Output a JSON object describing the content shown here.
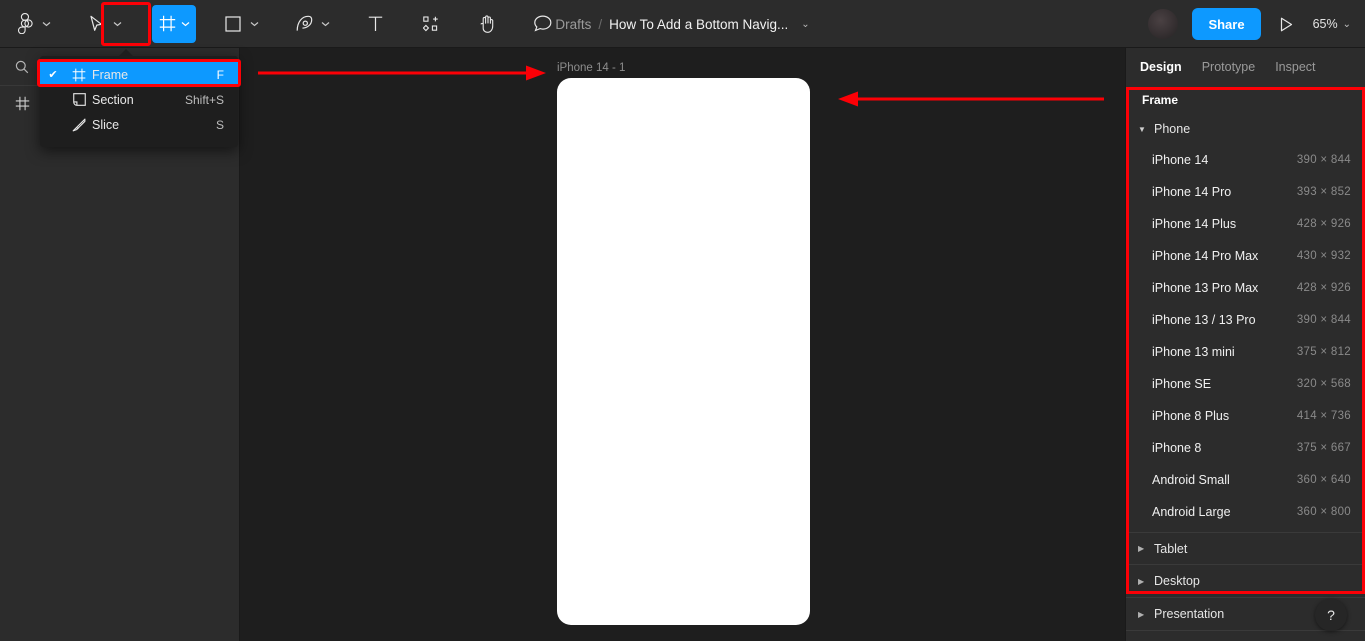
{
  "app": {
    "name": "Figma",
    "accent_color": "#0d99ff",
    "annotation_color": "#fc0006",
    "bg_color": "#1e1e1e",
    "panel_color": "#2c2c2c"
  },
  "toolbar": {
    "tools": [
      {
        "name": "figma-menu",
        "icon": "figma-logo-icon",
        "has_caret": true,
        "active": false
      },
      {
        "name": "move-tool",
        "icon": "cursor-arrow-icon",
        "has_caret": true,
        "active": false
      },
      {
        "name": "frame-tool",
        "icon": "frame-icon",
        "has_caret": true,
        "active": true
      },
      {
        "name": "shape-tool",
        "icon": "square-icon",
        "has_caret": true,
        "active": false
      },
      {
        "name": "pen-tool",
        "icon": "pen-icon",
        "has_caret": true,
        "active": false
      },
      {
        "name": "text-tool",
        "icon": "text-t-icon",
        "has_caret": false,
        "active": false
      },
      {
        "name": "resources-tool",
        "icon": "components-plus-icon",
        "has_caret": false,
        "active": false
      },
      {
        "name": "hand-tool",
        "icon": "hand-icon",
        "has_caret": false,
        "active": false
      },
      {
        "name": "comment-tool",
        "icon": "comment-bubble-icon",
        "has_caret": false,
        "active": false
      }
    ],
    "breadcrumb": {
      "project": "Drafts",
      "separator": "/",
      "file_title": "How To Add a Bottom Navig...",
      "caret": "⌄"
    },
    "share_label": "Share",
    "zoom_level": "65%",
    "zoom_caret": "⌄"
  },
  "left_panel": {
    "search_icon": "search-icon",
    "pages_icon": "hash-grid-icon"
  },
  "frame_menu": {
    "items": [
      {
        "label": "Frame",
        "shortcut": "F",
        "icon": "frame-icon",
        "checked": true,
        "selected": true
      },
      {
        "label": "Section",
        "shortcut": "Shift+S",
        "icon": "section-icon",
        "checked": false,
        "selected": false
      },
      {
        "label": "Slice",
        "shortcut": "S",
        "icon": "slice-knife-icon",
        "checked": false,
        "selected": false
      }
    ],
    "check_glyph": "✔"
  },
  "canvas": {
    "frame_label": "iPhone 14 - 1",
    "frame_fill": "#ffffff"
  },
  "right_panel": {
    "tabs": [
      {
        "label": "Design",
        "active": true
      },
      {
        "label": "Prototype",
        "active": false
      },
      {
        "label": "Inspect",
        "active": false
      }
    ],
    "frame_heading": "Frame",
    "group": {
      "label": "Phone",
      "caret": "▼",
      "expanded": true
    },
    "devices": [
      {
        "name": "iPhone 14",
        "size": "390 × 844"
      },
      {
        "name": "iPhone 14 Pro",
        "size": "393 × 852"
      },
      {
        "name": "iPhone 14 Plus",
        "size": "428 × 926"
      },
      {
        "name": "iPhone 14 Pro Max",
        "size": "430 × 932"
      },
      {
        "name": "iPhone 13 Pro Max",
        "size": "428 × 926"
      },
      {
        "name": "iPhone 13 / 13 Pro",
        "size": "390 × 844"
      },
      {
        "name": "iPhone 13 mini",
        "size": "375 × 812"
      },
      {
        "name": "iPhone SE",
        "size": "320 × 568"
      },
      {
        "name": "iPhone 8 Plus",
        "size": "414 × 736"
      },
      {
        "name": "iPhone 8",
        "size": "375 × 667"
      },
      {
        "name": "Android Small",
        "size": "360 × 640"
      },
      {
        "name": "Android Large",
        "size": "360 × 800"
      }
    ],
    "collapsed_sections": [
      {
        "label": "Tablet",
        "caret": "▶"
      },
      {
        "label": "Desktop",
        "caret": "▶"
      },
      {
        "label": "Presentation",
        "caret": "▶"
      }
    ]
  },
  "help": {
    "label": "?"
  },
  "annotations": [
    {
      "name": "arrow-to-canvas",
      "direction": "right"
    },
    {
      "name": "arrow-to-right-panel",
      "direction": "left"
    }
  ]
}
